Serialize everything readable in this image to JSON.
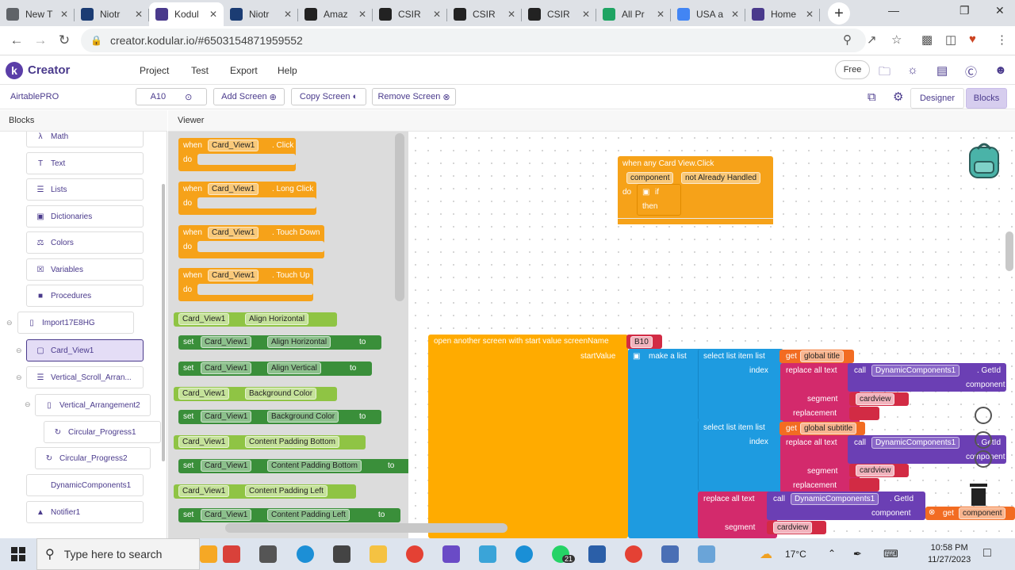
{
  "browser": {
    "tabs": [
      {
        "label": "New T",
        "favicon": "chrome-icon",
        "color": "#5f6368"
      },
      {
        "label": "Niotr",
        "favicon": "notion-icon",
        "color": "#1b3c73"
      },
      {
        "label": "Kodul",
        "favicon": "kodular-icon",
        "color": "#4a3a8c",
        "active": true
      },
      {
        "label": "Niotr",
        "favicon": "notion-icon",
        "color": "#1b3c73"
      },
      {
        "label": "Amaz",
        "favicon": "amazon-icon",
        "color": "#222222"
      },
      {
        "label": "CSIR",
        "favicon": "amazon-icon",
        "color": "#222222"
      },
      {
        "label": "CSIR",
        "favicon": "amazon-icon",
        "color": "#222222"
      },
      {
        "label": "CSIR",
        "favicon": "amazon-icon",
        "color": "#222222"
      },
      {
        "label": "All Pr",
        "favicon": "drive-icon",
        "color": "#1fa463"
      },
      {
        "label": "USA a",
        "favicon": "docs-icon",
        "color": "#4285f4"
      },
      {
        "label": "Home",
        "favicon": "kodular-icon",
        "color": "#4a3a8c"
      }
    ],
    "url": "creator.kodular.io/#6503154871959552"
  },
  "kodular": {
    "brand": "Creator",
    "menu": [
      "Project",
      "Test",
      "Export",
      "Help"
    ],
    "free_label": "Free",
    "project_name": "AirtablePRO",
    "screen_select": "A10",
    "add_screen": "Add Screen",
    "copy_screen": "Copy Screen",
    "remove_screen": "Remove Screen",
    "designer": "Designer",
    "blocks": "Blocks",
    "blocks_header": "Blocks",
    "viewer_header": "Viewer"
  },
  "sidebar": {
    "items": [
      {
        "label": "Math",
        "icon": "math-icon"
      },
      {
        "label": "Text",
        "icon": "text-icon"
      },
      {
        "label": "Lists",
        "icon": "lists-icon"
      },
      {
        "label": "Dictionaries",
        "icon": "dictionaries-icon"
      },
      {
        "label": "Colors",
        "icon": "colors-icon"
      },
      {
        "label": "Variables",
        "icon": "variables-icon"
      },
      {
        "label": "Procedures",
        "icon": "procedures-icon"
      },
      {
        "label": "Import17E8HG",
        "icon": "phone-icon"
      },
      {
        "label": "Card_View1",
        "icon": "card-icon",
        "selected": true
      },
      {
        "label": "Vertical_Scroll_Arran...",
        "icon": "vertical-scroll-icon"
      },
      {
        "label": "Vertical_Arrangement2",
        "icon": "vertical-arrangement-icon"
      },
      {
        "label": "Circular_Progress1",
        "icon": "progress-icon"
      },
      {
        "label": "Circular_Progress2",
        "icon": "progress-icon"
      },
      {
        "label": "DynamicComponents1",
        "icon": ""
      },
      {
        "label": "Notifier1",
        "icon": "notifier-icon"
      }
    ]
  },
  "flyout": {
    "events": [
      {
        "when": "when",
        "comp": "Card_View1",
        "event": ". Click",
        "do": "do"
      },
      {
        "when": "when",
        "comp": "Card_View1",
        "event": ". Long Click",
        "do": "do"
      },
      {
        "when": "when",
        "comp": "Card_View1",
        "event": ". Touch Down",
        "do": "do"
      },
      {
        "when": "when",
        "comp": "Card_View1",
        "event": ". Touch Up",
        "do": "do"
      }
    ],
    "props": [
      {
        "kind": "get",
        "comp": "Card_View1",
        "prop": "Align Horizontal"
      },
      {
        "kind": "set",
        "comp": "Card_View1",
        "prop": "Align Horizontal"
      },
      {
        "kind": "set",
        "comp": "Card_View1",
        "prop": "Align Vertical"
      },
      {
        "kind": "get",
        "comp": "Card_View1",
        "prop": "Background Color"
      },
      {
        "kind": "set",
        "comp": "Card_View1",
        "prop": "Background Color"
      },
      {
        "kind": "get",
        "comp": "Card_View1",
        "prop": "Content Padding Bottom"
      },
      {
        "kind": "set",
        "comp": "Card_View1",
        "prop": "Content Padding Bottom"
      },
      {
        "kind": "get",
        "comp": "Card_View1",
        "prop": "Content Padding Left"
      },
      {
        "kind": "set",
        "comp": "Card_View1",
        "prop": "Content Padding Left"
      }
    ],
    "set_word": "set",
    "to_word": "to"
  },
  "workspace": {
    "any_event": {
      "title": "when any Card View.Click",
      "component": "component",
      "not_handled": "not Already Handled",
      "do": "do",
      "if": "if",
      "then": "then"
    },
    "open_screen": {
      "label": "open another screen with start value  screenName",
      "start_value": "startValue",
      "screen": "B10"
    },
    "make_list": "make a list",
    "select1": {
      "label": "select list item  list",
      "index": "index",
      "get": "get",
      "var": "global title"
    },
    "select2": {
      "label": "select list item  list",
      "index": "index",
      "get": "get",
      "var": "global subtitle"
    },
    "replace": "replace all text",
    "call": "call",
    "dyn": "DynamicComponents1",
    "getid": ". GetId",
    "component": "component",
    "segment": "segment",
    "replacement": "replacement",
    "cardview": "cardview",
    "get_component": "component"
  },
  "taskbar": {
    "search_placeholder": "Type here to search",
    "weather": "17°C",
    "time": "10:58 PM",
    "date": "11/27/2023",
    "badge": "21"
  }
}
